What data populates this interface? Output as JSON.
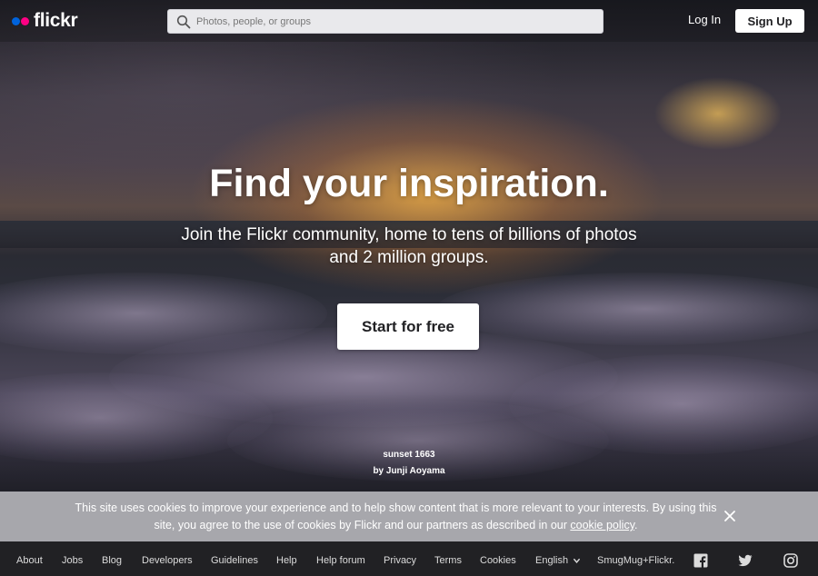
{
  "header": {
    "logo_text": "flickr",
    "brand_colors": {
      "blue": "#0063dc",
      "pink": "#ff0084"
    },
    "search": {
      "placeholder": "Photos, people, or groups",
      "icon": "search-icon"
    },
    "login_label": "Log In",
    "signup_label": "Sign Up"
  },
  "hero": {
    "headline": "Find your inspiration.",
    "subhead": "Join the Flickr community, home to tens of billions of photos and 2 million groups.",
    "cta_label": "Start for free",
    "photo_title": "sunset 1663",
    "photo_author": "by Junji Aoyama"
  },
  "cookie_banner": {
    "text_before_link": "This site uses cookies to improve your experience and to help show content that is more relevant to your interests. By using this site, you agree to the use of cookies by Flickr and our partners as described in our ",
    "link_text": "cookie policy",
    "text_after_link": ".",
    "close_icon": "close-icon"
  },
  "footer": {
    "links": [
      "About",
      "Jobs",
      "Blog",
      "Developers",
      "Guidelines",
      "Help",
      "Help forum",
      "Privacy",
      "Terms",
      "Cookies"
    ],
    "language": "English",
    "smugmug": "SmugMug+Flickr.",
    "social_icons": [
      "facebook-icon",
      "twitter-icon",
      "instagram-icon"
    ]
  }
}
